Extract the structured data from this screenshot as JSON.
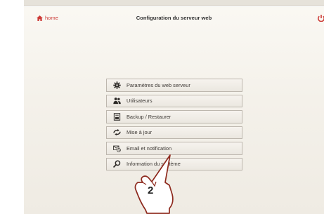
{
  "header": {
    "home_label": "home",
    "title": "Configuration du serveur web",
    "accent_color": "#cc3a36"
  },
  "menu": {
    "items": [
      {
        "label": "Paramètres du web serveur",
        "icon": "gear-icon"
      },
      {
        "label": "Utilisateurs",
        "icon": "users-icon"
      },
      {
        "label": "Backup / Restaurer",
        "icon": "backup-icon"
      },
      {
        "label": "Mise à jour",
        "icon": "update-icon"
      },
      {
        "label": "Email et notification",
        "icon": "email-icon"
      },
      {
        "label": "Information du système",
        "icon": "search-icon"
      }
    ]
  },
  "annotation": {
    "step_number": "2",
    "icon": "pointing-hand-icon"
  }
}
